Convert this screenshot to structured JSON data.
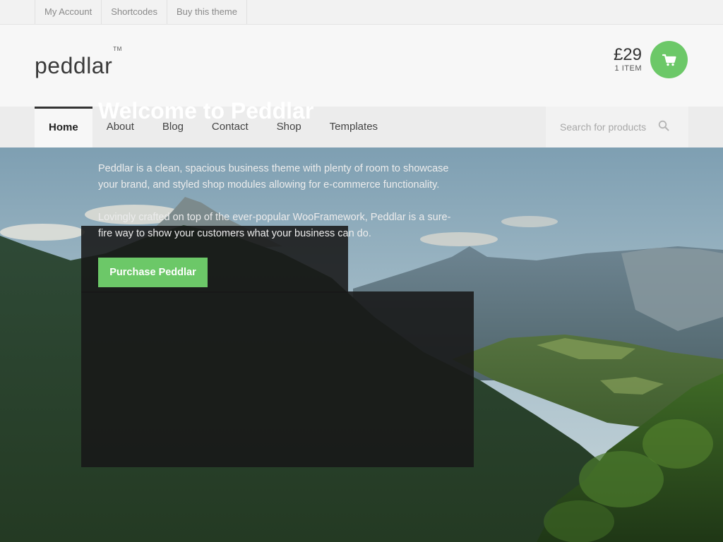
{
  "topbar": {
    "links": [
      "My Account",
      "Shortcodes",
      "Buy this theme"
    ]
  },
  "header": {
    "logo": "peddlar",
    "logo_mark": "TM",
    "cart": {
      "amount": "£29",
      "count": "1 ITEM",
      "icon": "cart-icon",
      "button_color": "#6cc868"
    }
  },
  "nav": {
    "items": [
      "Home",
      "About",
      "Blog",
      "Contact",
      "Shop",
      "Templates"
    ],
    "active": "Home",
    "search": {
      "placeholder": "Search for products",
      "icon": "search-icon"
    }
  },
  "hero": {
    "title": "Welcome to Peddlar",
    "paragraphs": [
      "Peddlar is a clean, spacious business theme with plenty of room to showcase your brand, and styled shop modules allowing for e-commerce functionality.",
      "Lovingly crafted on top of the ever-popular WooFramework, Peddlar is a sure-fire way to show your customers what your business can do."
    ],
    "button": "Purchase Peddlar",
    "accent_color": "#6cc868"
  }
}
